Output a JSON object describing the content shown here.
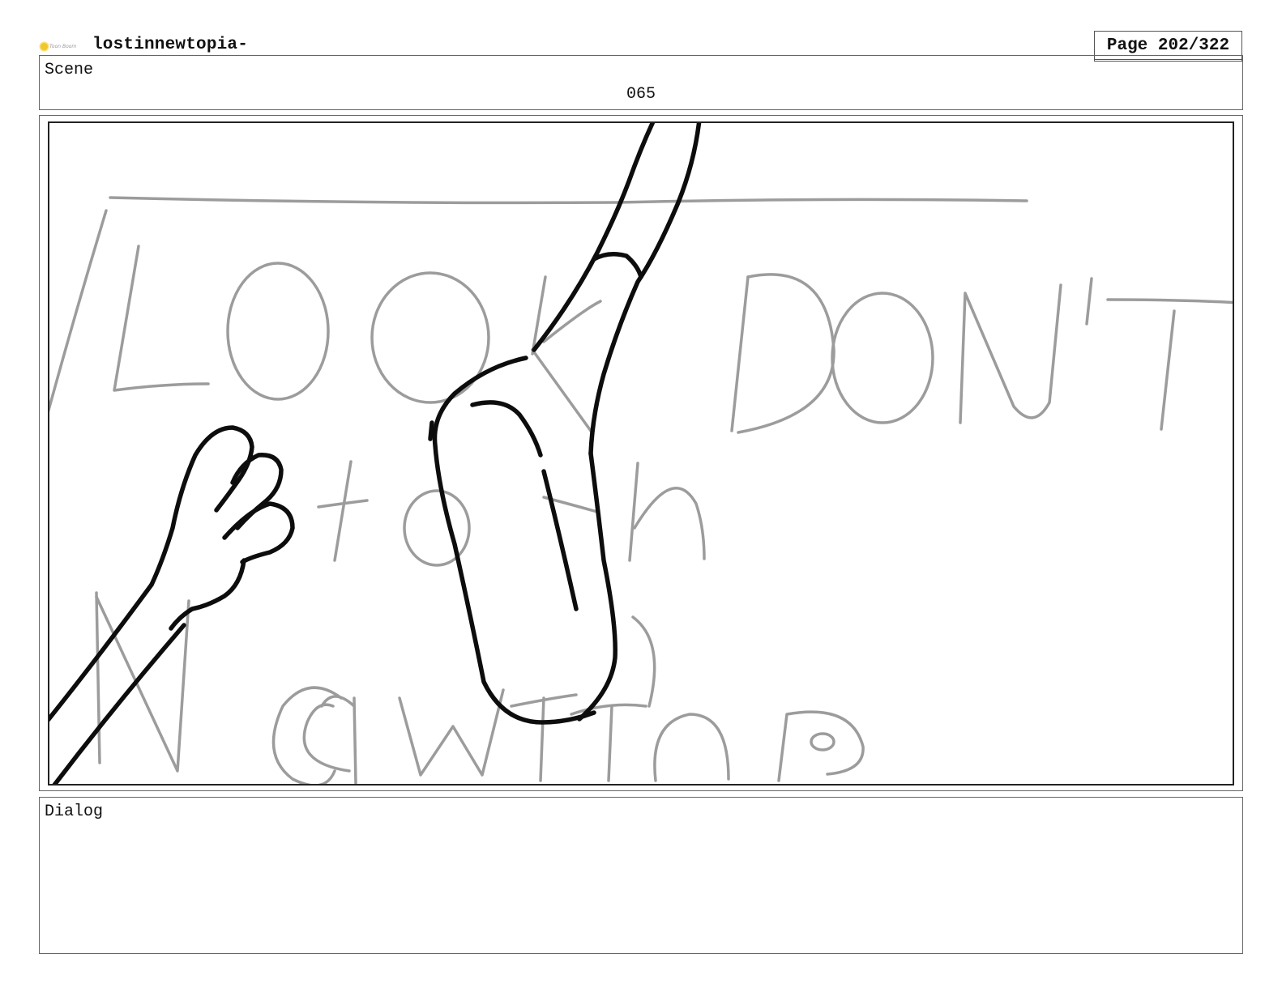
{
  "header": {
    "logo_text": "Toon Boom",
    "project_title": "lostinnewtopia-",
    "page_indicator": "Page 202/322"
  },
  "scene": {
    "label": "Scene",
    "number": "065"
  },
  "panel": {
    "sign_text": "LOOK DON'T touch NEWTOPIA"
  },
  "dialog": {
    "label": "Dialog",
    "text": ""
  }
}
